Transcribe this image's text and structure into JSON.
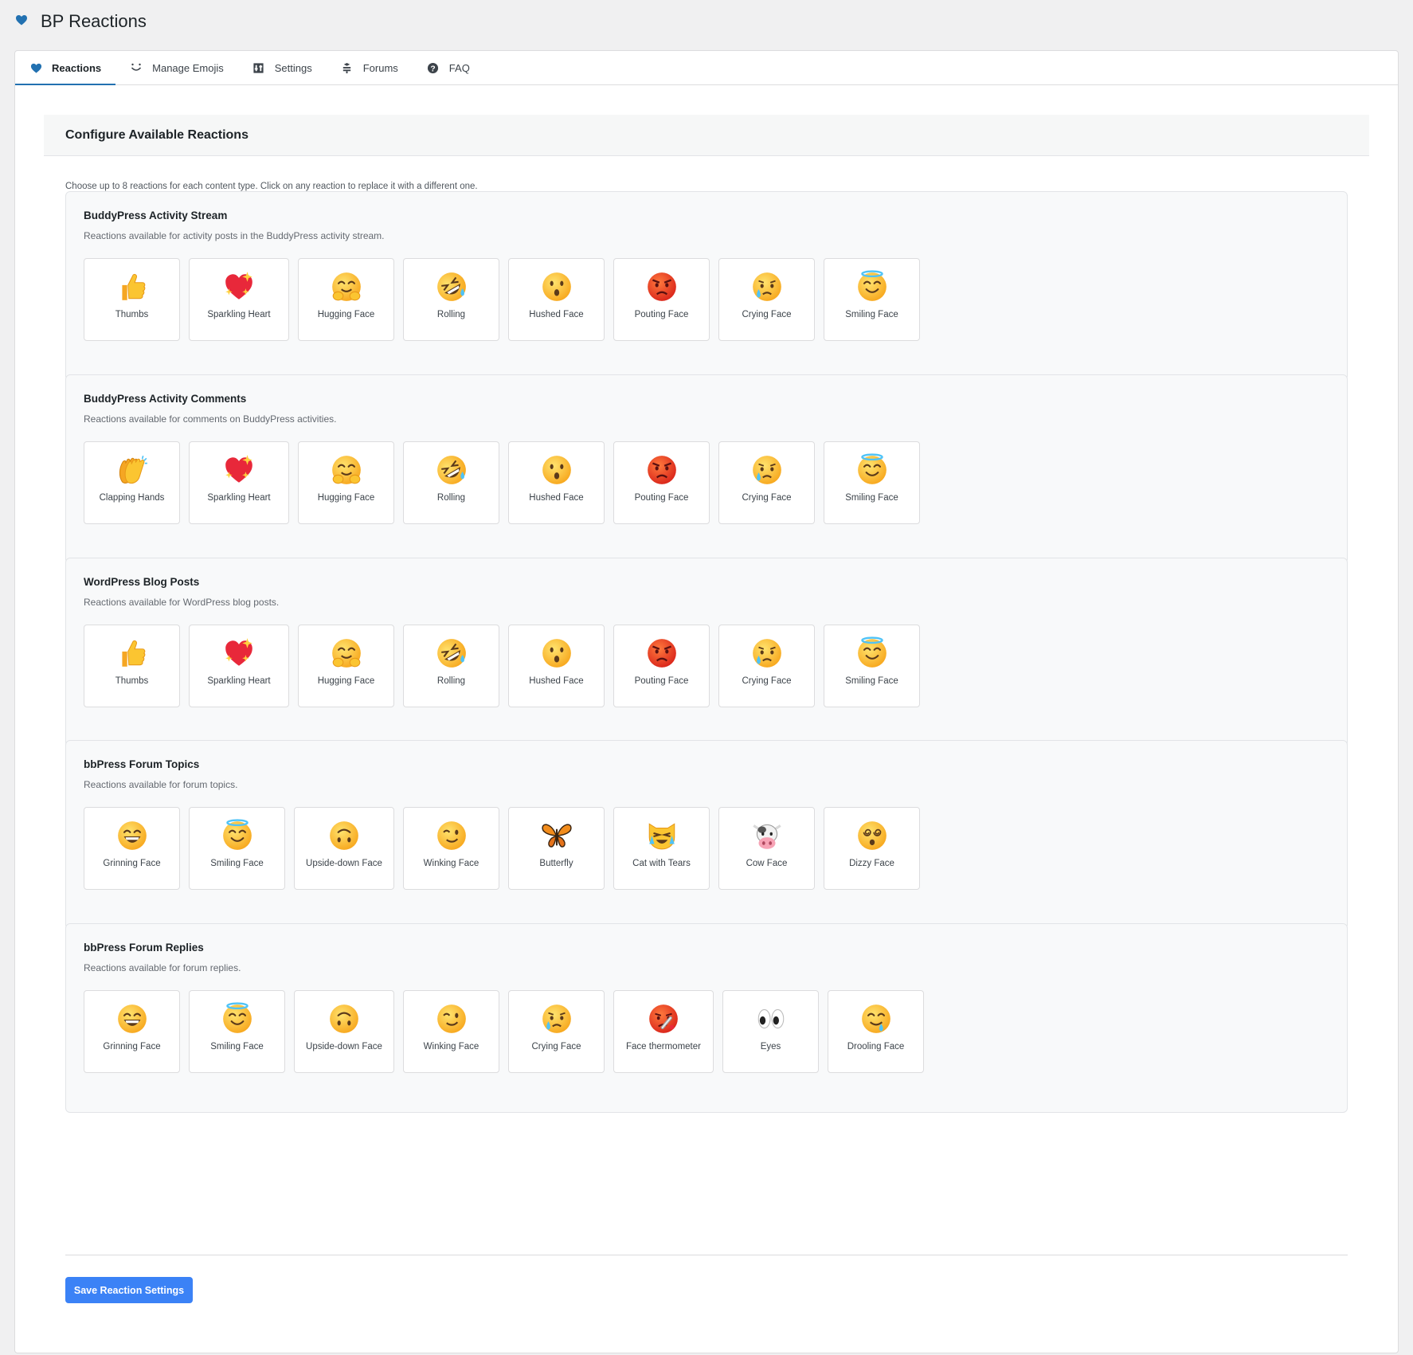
{
  "app": {
    "title": "BP Reactions",
    "accent": "#2271b1",
    "logo_icon": "heart-icon"
  },
  "tabs": [
    {
      "label": "Reactions",
      "icon": "heart-icon",
      "active": true
    },
    {
      "label": "Manage Emojis",
      "icon": "smile-icon",
      "active": false
    },
    {
      "label": "Settings",
      "icon": "settings-icon",
      "active": false
    },
    {
      "label": "Forums",
      "icon": "forums-icon",
      "active": false
    },
    {
      "label": "FAQ",
      "icon": "help-icon",
      "active": false
    }
  ],
  "main": {
    "heading": "Configure Available Reactions",
    "intro": "Choose up to 8 reactions for each content type. Click on any reaction to replace it with a different one."
  },
  "groups": [
    {
      "title": "BuddyPress Activity Stream",
      "description": "Reactions available for activity posts in the BuddyPress activity stream.",
      "reactions": [
        {
          "name": "Thumbs",
          "icon": "thumbs-up"
        },
        {
          "name": "Sparkling Heart",
          "icon": "sparkling-heart"
        },
        {
          "name": "Hugging Face",
          "icon": "hugging-face"
        },
        {
          "name": "Rolling",
          "icon": "rolling-laughing"
        },
        {
          "name": "Hushed Face",
          "icon": "hushed-face"
        },
        {
          "name": "Pouting Face",
          "icon": "pouting-face"
        },
        {
          "name": "Crying Face",
          "icon": "crying-face"
        },
        {
          "name": "Smiling Face",
          "icon": "halo-face"
        }
      ]
    },
    {
      "title": "BuddyPress Activity Comments",
      "description": "Reactions available for comments on BuddyPress activities.",
      "reactions": [
        {
          "name": "Clapping Hands",
          "icon": "clapping-hands"
        },
        {
          "name": "Sparkling Heart",
          "icon": "sparkling-heart"
        },
        {
          "name": "Hugging Face",
          "icon": "hugging-face"
        },
        {
          "name": "Rolling",
          "icon": "rolling-laughing"
        },
        {
          "name": "Hushed Face",
          "icon": "hushed-face"
        },
        {
          "name": "Pouting Face",
          "icon": "pouting-face"
        },
        {
          "name": "Crying Face",
          "icon": "crying-face"
        },
        {
          "name": "Smiling Face",
          "icon": "halo-face"
        }
      ]
    },
    {
      "title": "WordPress Blog Posts",
      "description": "Reactions available for WordPress blog posts.",
      "reactions": [
        {
          "name": "Thumbs",
          "icon": "thumbs-up"
        },
        {
          "name": "Sparkling Heart",
          "icon": "sparkling-heart"
        },
        {
          "name": "Hugging Face",
          "icon": "hugging-face"
        },
        {
          "name": "Rolling",
          "icon": "rolling-laughing"
        },
        {
          "name": "Hushed Face",
          "icon": "hushed-face"
        },
        {
          "name": "Pouting Face",
          "icon": "pouting-face"
        },
        {
          "name": "Crying Face",
          "icon": "crying-face"
        },
        {
          "name": "Smiling Face",
          "icon": "halo-face"
        }
      ]
    },
    {
      "title": "bbPress Forum Topics",
      "description": "Reactions available for forum topics.",
      "reactions": [
        {
          "name": "Grinning Face",
          "icon": "grinning-face"
        },
        {
          "name": "Smiling Face",
          "icon": "halo-face"
        },
        {
          "name": "Upside-down Face",
          "icon": "upside-down-face"
        },
        {
          "name": "Winking Face",
          "icon": "winking-face"
        },
        {
          "name": "Butterfly",
          "icon": "butterfly"
        },
        {
          "name": "Cat with Tears",
          "icon": "cat-tears"
        },
        {
          "name": "Cow Face",
          "icon": "cow-face"
        },
        {
          "name": "Dizzy Face",
          "icon": "dizzy-face"
        }
      ]
    },
    {
      "title": "bbPress Forum Replies",
      "description": "Reactions available for forum replies.",
      "reactions": [
        {
          "name": "Grinning Face",
          "icon": "grinning-face"
        },
        {
          "name": "Smiling Face",
          "icon": "halo-face"
        },
        {
          "name": "Upside-down Face",
          "icon": "upside-down-face"
        },
        {
          "name": "Winking Face",
          "icon": "winking-face"
        },
        {
          "name": "Crying Face",
          "icon": "crying-face"
        },
        {
          "name": "Face thermometer",
          "icon": "thermometer-face"
        },
        {
          "name": "Eyes",
          "icon": "eyes"
        },
        {
          "name": "Drooling Face",
          "icon": "drooling-face"
        }
      ]
    }
  ],
  "actions": {
    "save_label": "Save Reaction Settings",
    "save_color": "#3b82f6"
  }
}
